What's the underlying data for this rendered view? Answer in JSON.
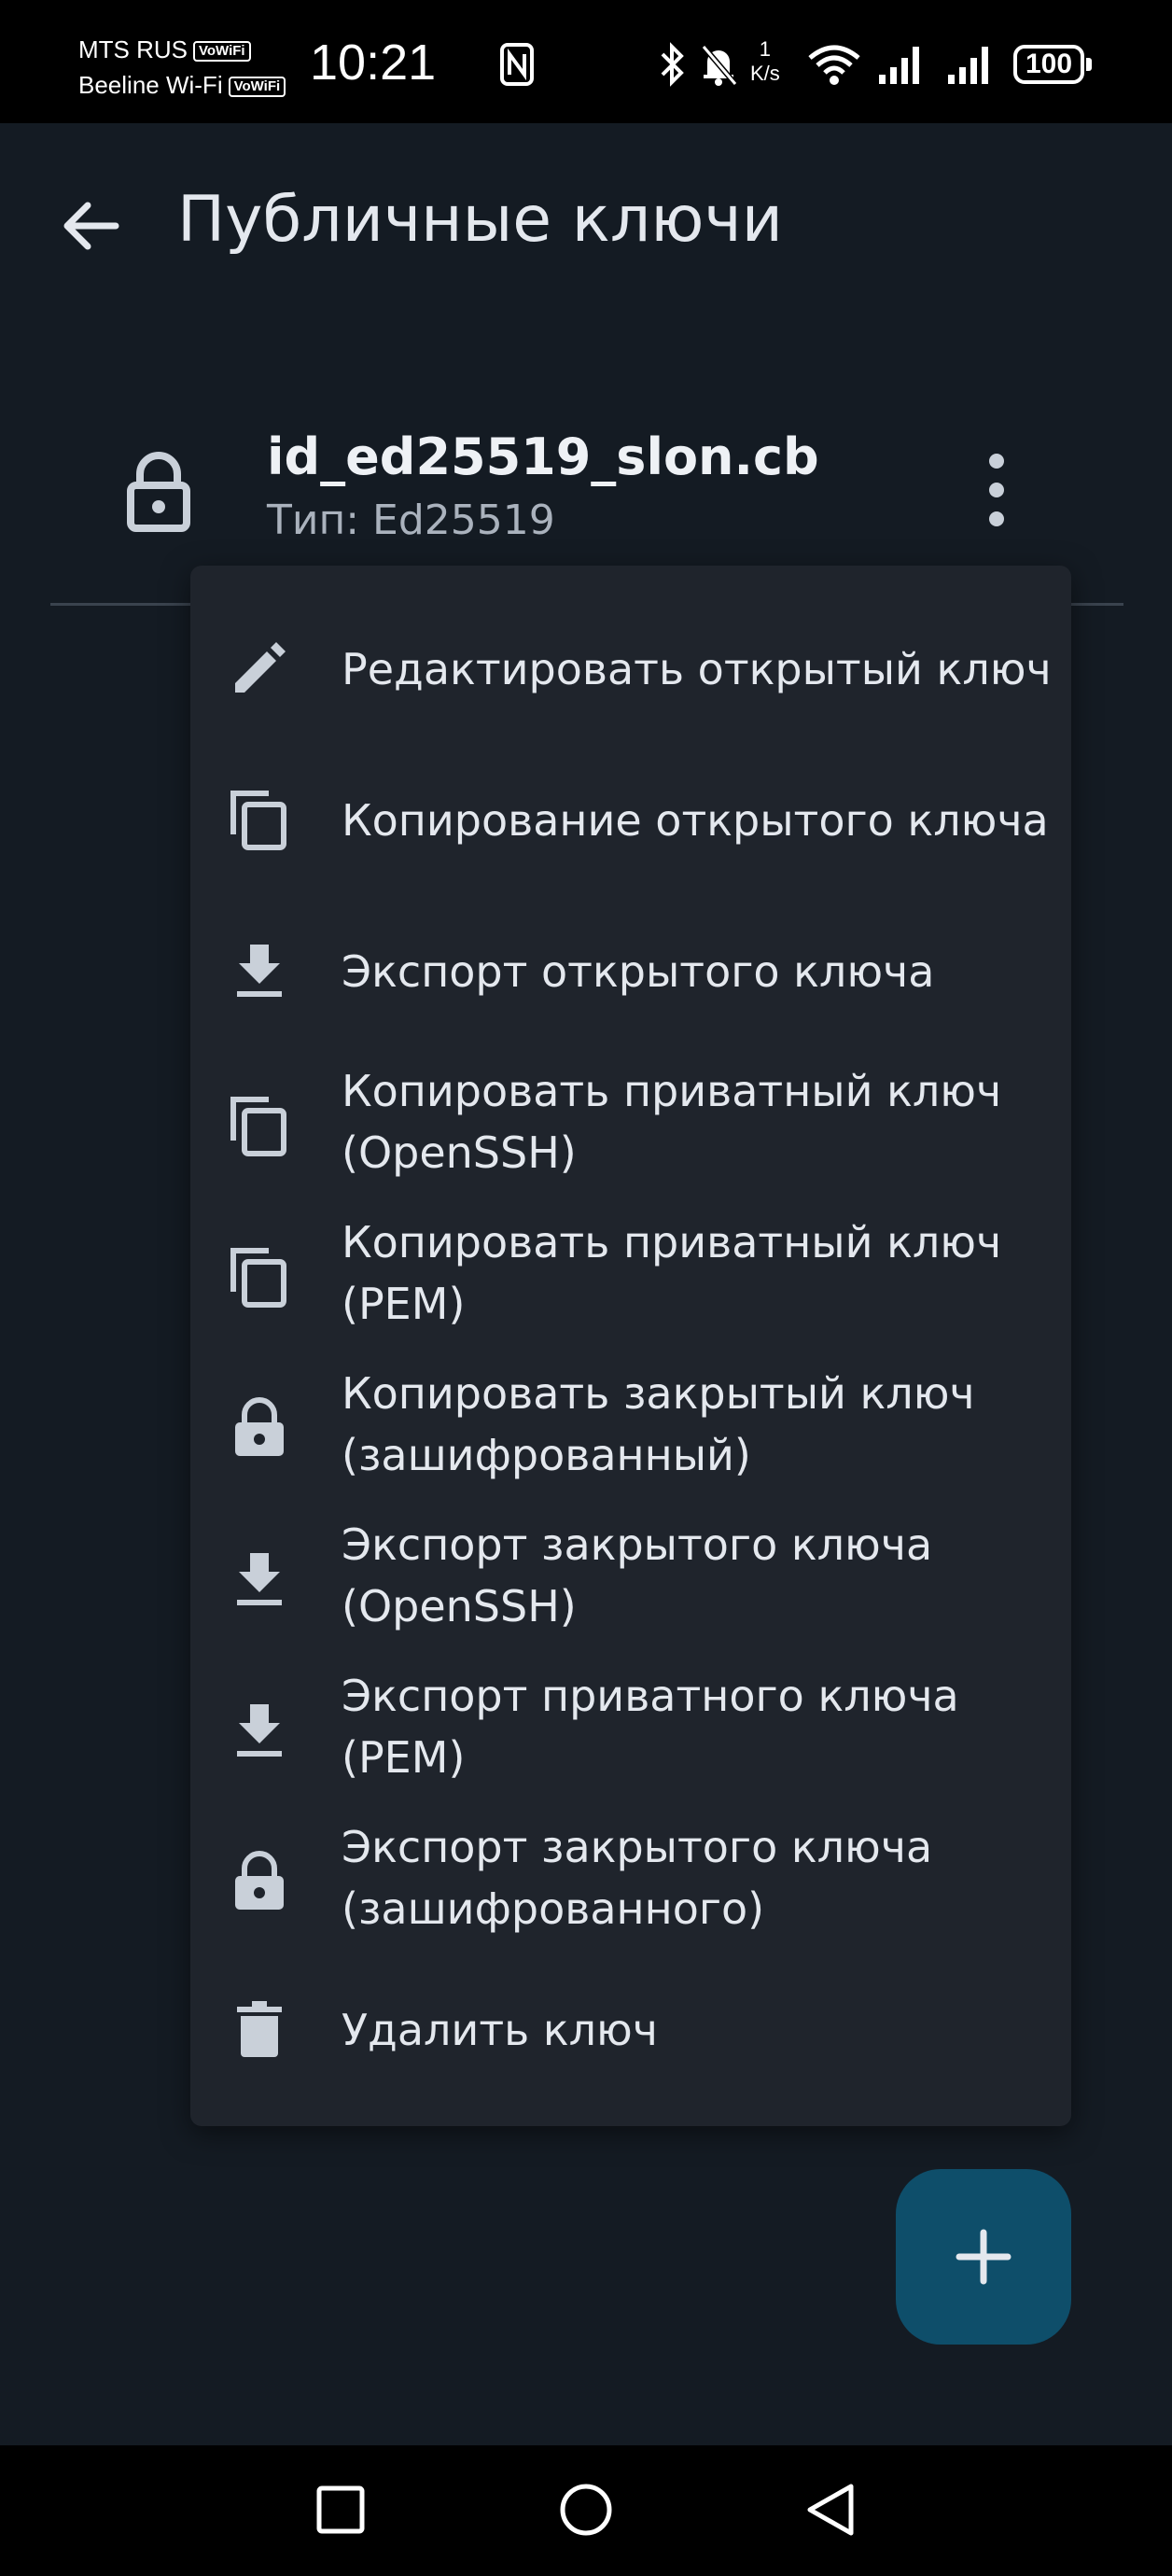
{
  "status_bar": {
    "carrier_1": "MTS RUS",
    "carrier_1_badge": "VoWiFi",
    "carrier_2": "Beeline Wi-Fi",
    "carrier_2_badge": "VoWiFi",
    "time": "10:21",
    "net_speed_value": "1",
    "net_speed_unit": "K/s",
    "battery": "100"
  },
  "app_bar": {
    "title": "Публичные ключи",
    "back_icon": "arrow-back-icon"
  },
  "key": {
    "name": "id_ed25519_slon.cb",
    "type": "Тип: Ed25519",
    "icon": "lock-icon"
  },
  "menu": {
    "items": [
      {
        "icon": "pencil-icon",
        "label": "Редактировать открытый ключ"
      },
      {
        "icon": "copy-icon",
        "label": "Копирование открытого ключа"
      },
      {
        "icon": "download-icon",
        "label": "Экспорт открытого ключа"
      },
      {
        "icon": "copy-icon",
        "label": "Копировать приватный ключ (OpenSSH)"
      },
      {
        "icon": "copy-icon",
        "label": "Копировать приватный ключ (PEM)"
      },
      {
        "icon": "lock-icon",
        "label": "Копировать закрытый ключ (зашифрованный)"
      },
      {
        "icon": "download-icon",
        "label": "Экспорт закрытого ключа (OpenSSH)"
      },
      {
        "icon": "download-icon",
        "label": "Экспорт приватного ключа (PEM)"
      },
      {
        "icon": "lock-icon",
        "label": "Экспорт закрытого ключа (зашифрованного)"
      },
      {
        "icon": "trash-icon",
        "label": "Удалить ключ"
      }
    ]
  },
  "fab": {
    "icon": "plus-icon"
  },
  "colors": {
    "background": "#141b23",
    "menu_background": "#1f242c",
    "fab": "#0e4e6a",
    "text": "#e4e8ee"
  }
}
